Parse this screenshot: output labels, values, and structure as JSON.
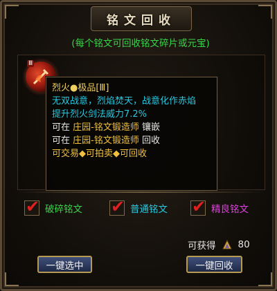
{
  "window": {
    "title": "铭文回收",
    "subtitle": "(每个铭文可回收铭文碎片或元宝)"
  },
  "item": {
    "icon": "fire-rune-icon"
  },
  "tooltip": {
    "title": "烈火●极品[Ⅲ]",
    "description": "无双战意，烈焰焚天，战意化作赤焰",
    "effect": "提升烈火剑法威力7.2%",
    "line1": {
      "prefix": "可在",
      "location": "庄园-铭文锻造师",
      "action": "镶嵌"
    },
    "line2": {
      "prefix": "可在",
      "location": "庄园-铭文锻造师",
      "action": "回收"
    },
    "trade": "可交易◆可拍卖◆可回收"
  },
  "filters": [
    {
      "label": "破碎铭文",
      "checked": true,
      "color": "#39d64a"
    },
    {
      "label": "普通铭文",
      "checked": true,
      "color": "#28c8e0"
    },
    {
      "label": "精良铭文",
      "checked": true,
      "color": "#e040e0"
    }
  ],
  "gain": {
    "label": "可获得",
    "icon": "fragment-icon",
    "value": "80"
  },
  "buttons": {
    "select_all": "一键选中",
    "recycle_all": "一键回收"
  }
}
